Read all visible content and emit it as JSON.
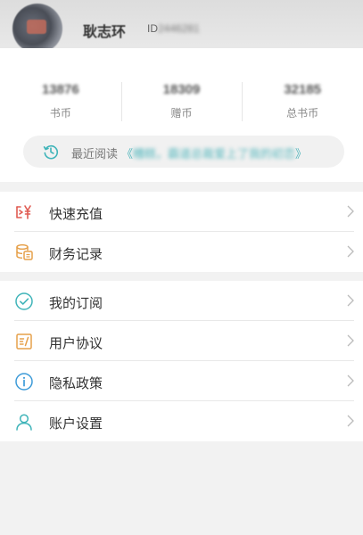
{
  "user": {
    "name": "耿志环",
    "id_prefix": "ID",
    "id_value": "2446281"
  },
  "stats": [
    {
      "value": "13876",
      "label": "书币"
    },
    {
      "value": "18309",
      "label": "赠币"
    },
    {
      "value": "32185",
      "label": "总书币"
    }
  ],
  "recent": {
    "label": "最近阅读",
    "title_open": "《",
    "title": "糟糕，霸道总裁爱上了我的初恋",
    "title_close": "》"
  },
  "menu": {
    "recharge": "快速充值",
    "finance": "财务记录",
    "subscriptions": "我的订阅",
    "agreement": "用户协议",
    "privacy": "隐私政策",
    "settings": "账户设置"
  },
  "colors": {
    "accent_teal": "#3fb4b9",
    "accent_red": "#e05b52",
    "accent_orange": "#e6a04a",
    "accent_blue": "#3d9bd8"
  }
}
